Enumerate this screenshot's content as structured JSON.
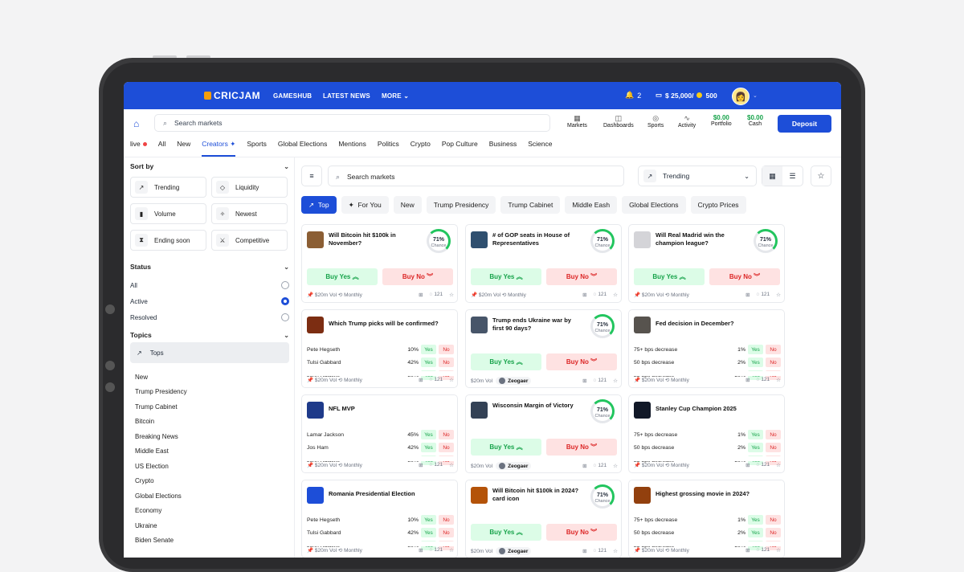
{
  "topbar": {
    "logo": "CRICJAM",
    "nav": [
      "GAMESHUB",
      "LATEST NEWS",
      "MORE"
    ],
    "notifications": "2",
    "balance": "$ 25,000/",
    "coins": "500"
  },
  "header": {
    "search_placeholder": "Search markets",
    "tools": [
      {
        "label": "Markets",
        "icon": "grid-icon"
      },
      {
        "label": "Dashboards",
        "icon": "dashboard-icon"
      },
      {
        "label": "Sports",
        "icon": "sports-icon"
      },
      {
        "label": "Activity",
        "icon": "activity-icon"
      }
    ],
    "portfolio_value": "$0.00",
    "portfolio_label": "Portfolio",
    "cash_value": "$0.00",
    "cash_label": "Cash",
    "deposit": "Deposit"
  },
  "categories": [
    "live",
    "All",
    "New",
    "Creators",
    "Sports",
    "Global Elections",
    "Mentions",
    "Politics",
    "Crypto",
    "Pop Culture",
    "Business",
    "Science"
  ],
  "sidebar": {
    "sort_title": "Sort by",
    "sort_options": [
      "Trending",
      "Liquidity",
      "Volume",
      "Newest",
      "Ending soon",
      "Competitive"
    ],
    "status_title": "Status",
    "status_options": [
      "All",
      "Active",
      "Resolved"
    ],
    "status_selected": "Active",
    "topics_title": "Topics",
    "topics_selected": "Tops",
    "topics": [
      "New",
      "Trump Presidency",
      "Trump Cabinet",
      "Bitcoin",
      "Breaking News",
      "Middle East",
      "US Election",
      "Crypto",
      "Global Elections",
      "Economy",
      "Ukraine",
      "Biden Senate"
    ]
  },
  "main": {
    "search_placeholder": "Search markets",
    "sort_value": "Trending",
    "chips": [
      "Top",
      "For You",
      "New",
      "Trump Presidency",
      "Trump Cabinet",
      "Middle Eash",
      "Global Elections",
      "Crypto Prices"
    ]
  },
  "cards": [
    {
      "type": "binary",
      "title": "Will Bitcoin hit $100k in November?",
      "chance": "71%",
      "chance_label": "Chance",
      "yes": "Buy Yes",
      "no": "Buy No",
      "vol": "$20m Vol",
      "freq": "Monthly",
      "comments": "121"
    },
    {
      "type": "binary",
      "title": "# of GOP seats in House of Representatives",
      "chance": "71%",
      "chance_label": "Chance",
      "yes": "Buy Yes",
      "no": "Buy No",
      "vol": "$20m Vol",
      "freq": "Monthly",
      "comments": "121"
    },
    {
      "type": "binary",
      "title": "Will Real Madrid win the champion league?",
      "chance": "71%",
      "chance_label": "Chance",
      "yes": "Buy Yes",
      "no": "Buy No",
      "vol": "$20m Vol",
      "freq": "Monthly",
      "comments": "121"
    },
    {
      "type": "multi",
      "title": "Which Trump picks will be confirmed?",
      "rows": [
        [
          "Pete Hegseth",
          "10%"
        ],
        [
          "Tulsi Gabbard",
          "42%"
        ],
        [
          "John Ratcliffe",
          "80%"
        ]
      ],
      "vol": "$20m Vol",
      "freq": "Monthly",
      "comments": "121"
    },
    {
      "type": "creator",
      "title": "Trump ends Ukraine war by first 90 days?",
      "chance": "71%",
      "chance_label": "Chance",
      "yes": "Buy Yes",
      "no": "Buy No",
      "vol": "$20m Vol",
      "creator": "Zeogaer",
      "comments": "121"
    },
    {
      "type": "multi",
      "title": "Fed decision in December?",
      "rows": [
        [
          "75+ bps decrease",
          "1%"
        ],
        [
          "50 bps decrease",
          "2%"
        ],
        [
          "25 bps decrease",
          "30%"
        ]
      ],
      "vol": "$20m Vol",
      "freq": "Monthly",
      "comments": "121"
    },
    {
      "type": "multi",
      "title": "NFL MVP",
      "rows": [
        [
          "Lamar Jackson",
          "45%"
        ],
        [
          "Jos Ham",
          "42%"
        ],
        [
          "John Ratcliffe",
          "80%"
        ]
      ],
      "vol": "$20m Vol",
      "freq": "Monthly",
      "comments": "121"
    },
    {
      "type": "creator",
      "title": "Wisconsin Margin of Victory",
      "chance": "71%",
      "chance_label": "Chance",
      "yes": "Buy Yes",
      "no": "Buy No",
      "vol": "$20m Vol",
      "creator": "Zeogaer",
      "comments": "121"
    },
    {
      "type": "multi",
      "title": "Stanley Cup Champion 2025",
      "rows": [
        [
          "75+ bps decrease",
          "1%"
        ],
        [
          "50 bps decrease",
          "2%"
        ],
        [
          "25 bps decrease",
          "30%"
        ]
      ],
      "vol": "$20m Vol",
      "freq": "Monthly",
      "comments": "121"
    },
    {
      "type": "multi",
      "title": "Romania Presidential Election",
      "rows": [
        [
          "Pete Hegseth",
          "10%"
        ],
        [
          "Tulsi Gabbard",
          "42%"
        ],
        [
          "John Ratcliffe",
          "80%"
        ]
      ],
      "vol": "$20m Vol",
      "freq": "Monthly",
      "comments": "121"
    },
    {
      "type": "creator",
      "title": "Will Bitcoin hit $100k in 2024? card icon",
      "chance": "71%",
      "chance_label": "Chance",
      "yes": "Buy Yes",
      "no": "Buy No",
      "vol": "$20m Vol",
      "creator": "Zeogaer",
      "comments": "121"
    },
    {
      "type": "multi",
      "title": "Highest grossing movie in 2024?",
      "rows": [
        [
          "75+ bps decrease",
          "1%"
        ],
        [
          "50 bps decrease",
          "2%"
        ],
        [
          "25 bps decrease",
          "30%"
        ]
      ],
      "vol": "$20m Vol",
      "freq": "Monthly",
      "comments": "121"
    }
  ],
  "labels": {
    "yes": "Yes",
    "no": "No"
  },
  "colors": {
    "brand": "#1d4ed8",
    "yes": "#16a34a",
    "no": "#dc2626"
  }
}
